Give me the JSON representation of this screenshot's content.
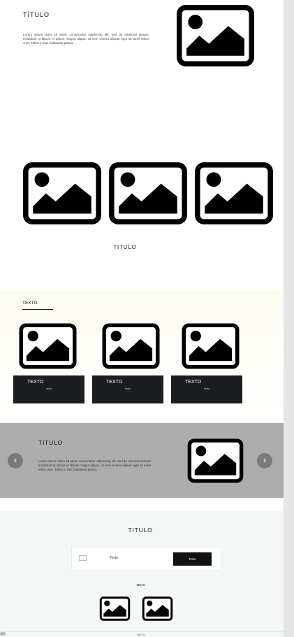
{
  "hero": {
    "title": "TÍTULO",
    "text": "Lorem ipsum dolor sit amet, consectetur adipiscing elit, sed do eiusmod tempor incididunt ut labore et dolore magna aliqua. Ut sem viverra aliquet eget sit amet tellus cras. Tellus in hac habitasse platea.",
    "image_icon": "image-placeholder-icon"
  },
  "gallery": {
    "title": "TITULO",
    "image_icon": "image-placeholder-icon"
  },
  "cards": {
    "label": "TEXTO",
    "items": [
      {
        "title": "TEXTO",
        "subtitle": "texto"
      },
      {
        "title": "TEXTO",
        "subtitle": "texto"
      },
      {
        "title": "TEXTO",
        "subtitle": "texto"
      }
    ]
  },
  "slider": {
    "title": "TITULO",
    "text": "Lorem ipsum dolor sit amet, consectetur adipiscing elit, sed do eiusmod tempor incididunt ut labore et dolore magna aliqua. Ut sem viverra aliquet eget sit amet tellus cras. Tellus in hac habitasse platea.",
    "prev_icon": "chevron-left-icon",
    "next_icon": "chevron-right-icon",
    "prev_glyph": "‹",
    "next_glyph": "›"
  },
  "contact": {
    "title": "TITULO",
    "input_value": "Texto",
    "button_label": "Texto",
    "label": "TEXTO",
    "footer": "TEXTO",
    "mail_icon": "mail-icon"
  },
  "colors": {
    "dark_card": "#1b1d1e",
    "slider_bg": "#adadad",
    "contact_bg": "#f3f8f7"
  }
}
